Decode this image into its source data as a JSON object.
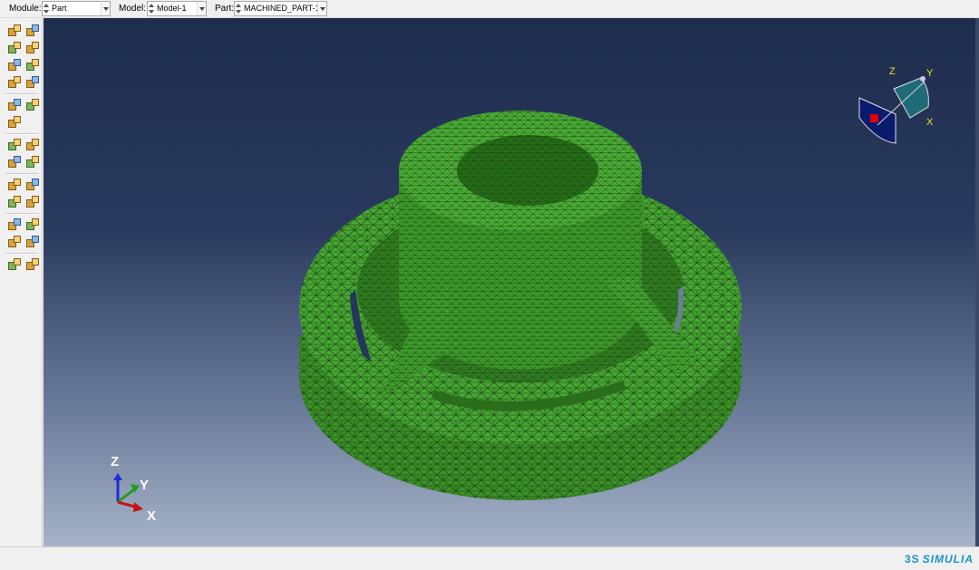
{
  "context_bar": {
    "module": {
      "label": "Module:",
      "value": "Part"
    },
    "model": {
      "label": "Model:",
      "value": "Model-1"
    },
    "part": {
      "label": "Part:",
      "value": "MACHINED_PART-1"
    }
  },
  "toolbox": {
    "groups": [
      [
        "create-part-icon",
        "part-manager-icon",
        "create-solid-extrude-icon",
        "create-shell-icon",
        "create-wire-icon",
        "create-cut-icon",
        "create-round-fillet-icon",
        "create-partition-icon"
      ],
      [
        "datum-point-icon",
        "datum-axis-icon",
        "datum-plane-icon"
      ],
      [
        "create-set-icon",
        "create-surface-icon",
        "query-icon",
        "measure-icon"
      ],
      [
        "datum-csys-icon",
        "triad-icon",
        "reference-point-icon",
        "display-group-icon"
      ],
      [
        "geometry-edit-icon",
        "virtual-topology-icon",
        "repair-icon",
        "tools-icon"
      ],
      [
        "transform-icon",
        "replace-icon"
      ]
    ]
  },
  "viewport": {
    "background_top": "#1e2d4d",
    "background_bottom": "#a6b3c8",
    "mesh_color": "#3f9e2d",
    "mesh_line_color": "#1d3f12",
    "triad_labels": {
      "z": "Z",
      "y": "Y",
      "x": "X"
    },
    "view_cube_labels": {
      "z": "Z",
      "y": "Y",
      "x": "X"
    }
  },
  "branding": {
    "logo_text": "SIMULIA",
    "logo_mark": "3S"
  }
}
